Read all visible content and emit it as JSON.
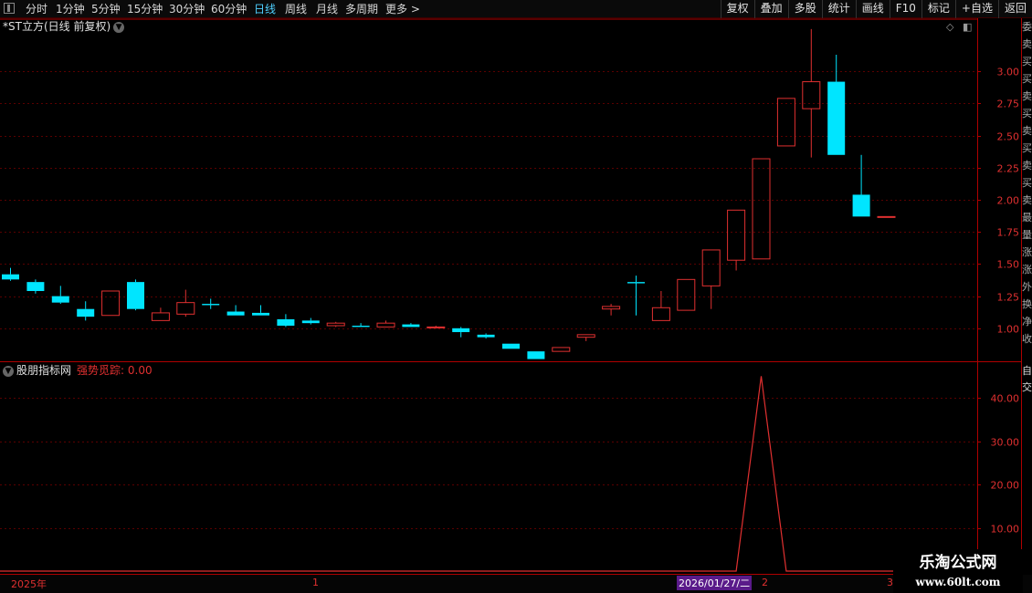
{
  "toolbar": {
    "periods": [
      "分时",
      "1分钟",
      "5分钟",
      "15分钟",
      "30分钟",
      "60分钟",
      "日线",
      "周线",
      "月线",
      "多周期",
      "更多 >"
    ],
    "active_period": "日线",
    "buttons": [
      "复权",
      "叠加",
      "多股",
      "统计",
      "画线",
      "F10",
      "标记",
      "+自选",
      "返回"
    ]
  },
  "main_title": "*ST立方(日线 前复权)",
  "sub_panel": {
    "name": "股朋指标网",
    "indicator": "强势觅踪: 0.00"
  },
  "right_strip_text": "委卖买买卖买卖买卖买卖最量涨涨外换净收",
  "right_strip2_text": "自 交",
  "date_axis": {
    "labels": [
      "2025年",
      "1",
      "2",
      "3"
    ],
    "cursor_date": "2026/01/27/二"
  },
  "watermark": {
    "line1": "乐淘公式网",
    "line2": "www.60lt.com"
  },
  "colors": {
    "up": "#e03030",
    "down": "#00e5ff",
    "grid": "#5a0000",
    "axis": "#b00000",
    "bg": "#000000"
  },
  "chart_data": [
    {
      "type": "candlestick",
      "title": "*ST立方(日线 前复权)",
      "ylim": [
        0.75,
        3.4
      ],
      "y_ticks": [
        1.0,
        1.25,
        1.5,
        1.75,
        2.0,
        2.25,
        2.5,
        2.75,
        3.0
      ],
      "y_tick_labels": [
        "1.00",
        "1.25",
        "1.50",
        "1.75",
        "2.00",
        "2.25",
        "2.50",
        "2.75",
        "3.00"
      ],
      "grid": true,
      "candles": [
        {
          "o": 1.42,
          "h": 1.47,
          "l": 1.37,
          "c": 1.38
        },
        {
          "o": 1.36,
          "h": 1.38,
          "l": 1.27,
          "c": 1.29
        },
        {
          "o": 1.25,
          "h": 1.33,
          "l": 1.19,
          "c": 1.2
        },
        {
          "o": 1.15,
          "h": 1.21,
          "l": 1.06,
          "c": 1.09
        },
        {
          "o": 1.1,
          "h": 1.29,
          "l": 1.1,
          "c": 1.29
        },
        {
          "o": 1.36,
          "h": 1.38,
          "l": 1.14,
          "c": 1.15
        },
        {
          "o": 1.06,
          "h": 1.16,
          "l": 1.06,
          "c": 1.12
        },
        {
          "o": 1.11,
          "h": 1.3,
          "l": 1.09,
          "c": 1.2
        },
        {
          "o": 1.19,
          "h": 1.23,
          "l": 1.15,
          "c": 1.18
        },
        {
          "o": 1.13,
          "h": 1.18,
          "l": 1.1,
          "c": 1.1
        },
        {
          "o": 1.12,
          "h": 1.18,
          "l": 1.1,
          "c": 1.1
        },
        {
          "o": 1.07,
          "h": 1.11,
          "l": 1.01,
          "c": 1.02
        },
        {
          "o": 1.06,
          "h": 1.08,
          "l": 1.03,
          "c": 1.04
        },
        {
          "o": 1.02,
          "h": 1.05,
          "l": 1.01,
          "c": 1.04
        },
        {
          "o": 1.02,
          "h": 1.04,
          "l": 1.01,
          "c": 1.01
        },
        {
          "o": 1.01,
          "h": 1.06,
          "l": 1.01,
          "c": 1.04
        },
        {
          "o": 1.03,
          "h": 1.04,
          "l": 1.01,
          "c": 1.01
        },
        {
          "o": 1.01,
          "h": 1.02,
          "l": 1.0,
          "c": 1.01
        },
        {
          "o": 1.0,
          "h": 1.01,
          "l": 0.93,
          "c": 0.97
        },
        {
          "o": 0.95,
          "h": 0.96,
          "l": 0.92,
          "c": 0.93
        },
        {
          "o": 0.88,
          "h": 0.88,
          "l": 0.84,
          "c": 0.84
        },
        {
          "o": 0.82,
          "h": 0.82,
          "l": 0.76,
          "c": 0.76
        },
        {
          "o": 0.82,
          "h": 0.85,
          "l": 0.82,
          "c": 0.85
        },
        {
          "o": 0.93,
          "h": 0.95,
          "l": 0.9,
          "c": 0.95
        },
        {
          "o": 1.15,
          "h": 1.19,
          "l": 1.1,
          "c": 1.17
        },
        {
          "o": 1.36,
          "h": 1.41,
          "l": 1.1,
          "c": 1.35
        },
        {
          "o": 1.06,
          "h": 1.29,
          "l": 1.06,
          "c": 1.16
        },
        {
          "o": 1.14,
          "h": 1.38,
          "l": 1.14,
          "c": 1.38
        },
        {
          "o": 1.33,
          "h": 1.61,
          "l": 1.15,
          "c": 1.61
        },
        {
          "o": 1.53,
          "h": 1.92,
          "l": 1.45,
          "c": 1.92
        },
        {
          "o": 1.54,
          "h": 2.32,
          "l": 1.54,
          "c": 2.32
        },
        {
          "o": 2.42,
          "h": 2.79,
          "l": 2.42,
          "c": 2.79
        },
        {
          "o": 2.71,
          "h": 3.33,
          "l": 2.33,
          "c": 2.92
        },
        {
          "o": 2.92,
          "h": 3.13,
          "l": 2.35,
          "c": 2.35
        },
        {
          "o": 2.04,
          "h": 2.35,
          "l": 1.87,
          "c": 1.87
        },
        {
          "o": 1.87,
          "h": 1.87,
          "l": 1.87,
          "c": 1.87
        }
      ]
    },
    {
      "type": "line",
      "title": "强势觅踪",
      "ylim": [
        0,
        48
      ],
      "y_ticks": [
        10,
        20,
        30,
        40
      ],
      "y_tick_labels": [
        "10.00",
        "20.00",
        "30.00",
        "40.00"
      ],
      "grid": true,
      "series": [
        {
          "values": [
            0,
            0,
            0,
            0,
            0,
            0,
            0,
            0,
            0,
            0,
            0,
            0,
            0,
            0,
            0,
            0,
            0,
            0,
            0,
            0,
            0,
            0,
            0,
            0,
            0,
            0,
            0,
            0,
            0,
            0,
            45,
            0,
            0,
            0,
            0,
            0
          ]
        }
      ]
    }
  ]
}
